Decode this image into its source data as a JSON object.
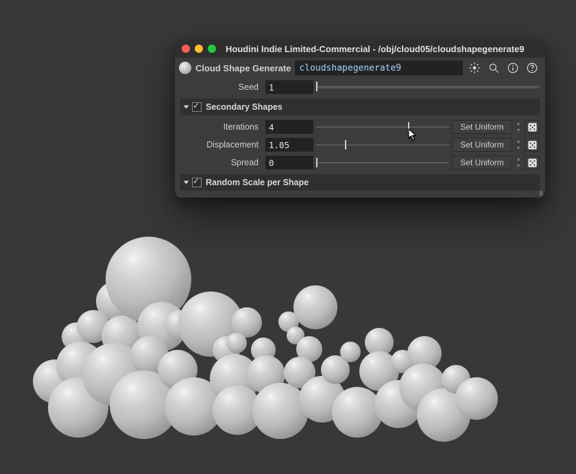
{
  "window": {
    "title": "Houdini Indie Limited-Commercial - /obj/cloud05/cloudshapegenerate9"
  },
  "node": {
    "type_label": "Cloud Shape Generate",
    "path": "cloudshapegenerate9"
  },
  "icons": {
    "gear": "gear-icon",
    "search": "search-icon",
    "info": "info-icon",
    "help": "help-icon"
  },
  "params": {
    "seed": {
      "label": "Seed",
      "value": "1"
    },
    "iterations": {
      "label": "Iterations",
      "value": "4",
      "action": "Set Uniform"
    },
    "displacement": {
      "label": "Displacement",
      "value": "1.05",
      "action": "Set Uniform"
    },
    "spread": {
      "label": "Spread",
      "value": "0",
      "action": "Set Uniform"
    }
  },
  "sections": {
    "secondary_shapes": {
      "label": "Secondary Shapes",
      "enabled": true
    },
    "random_scale": {
      "label": "Random Scale per Shape",
      "enabled": true
    }
  }
}
